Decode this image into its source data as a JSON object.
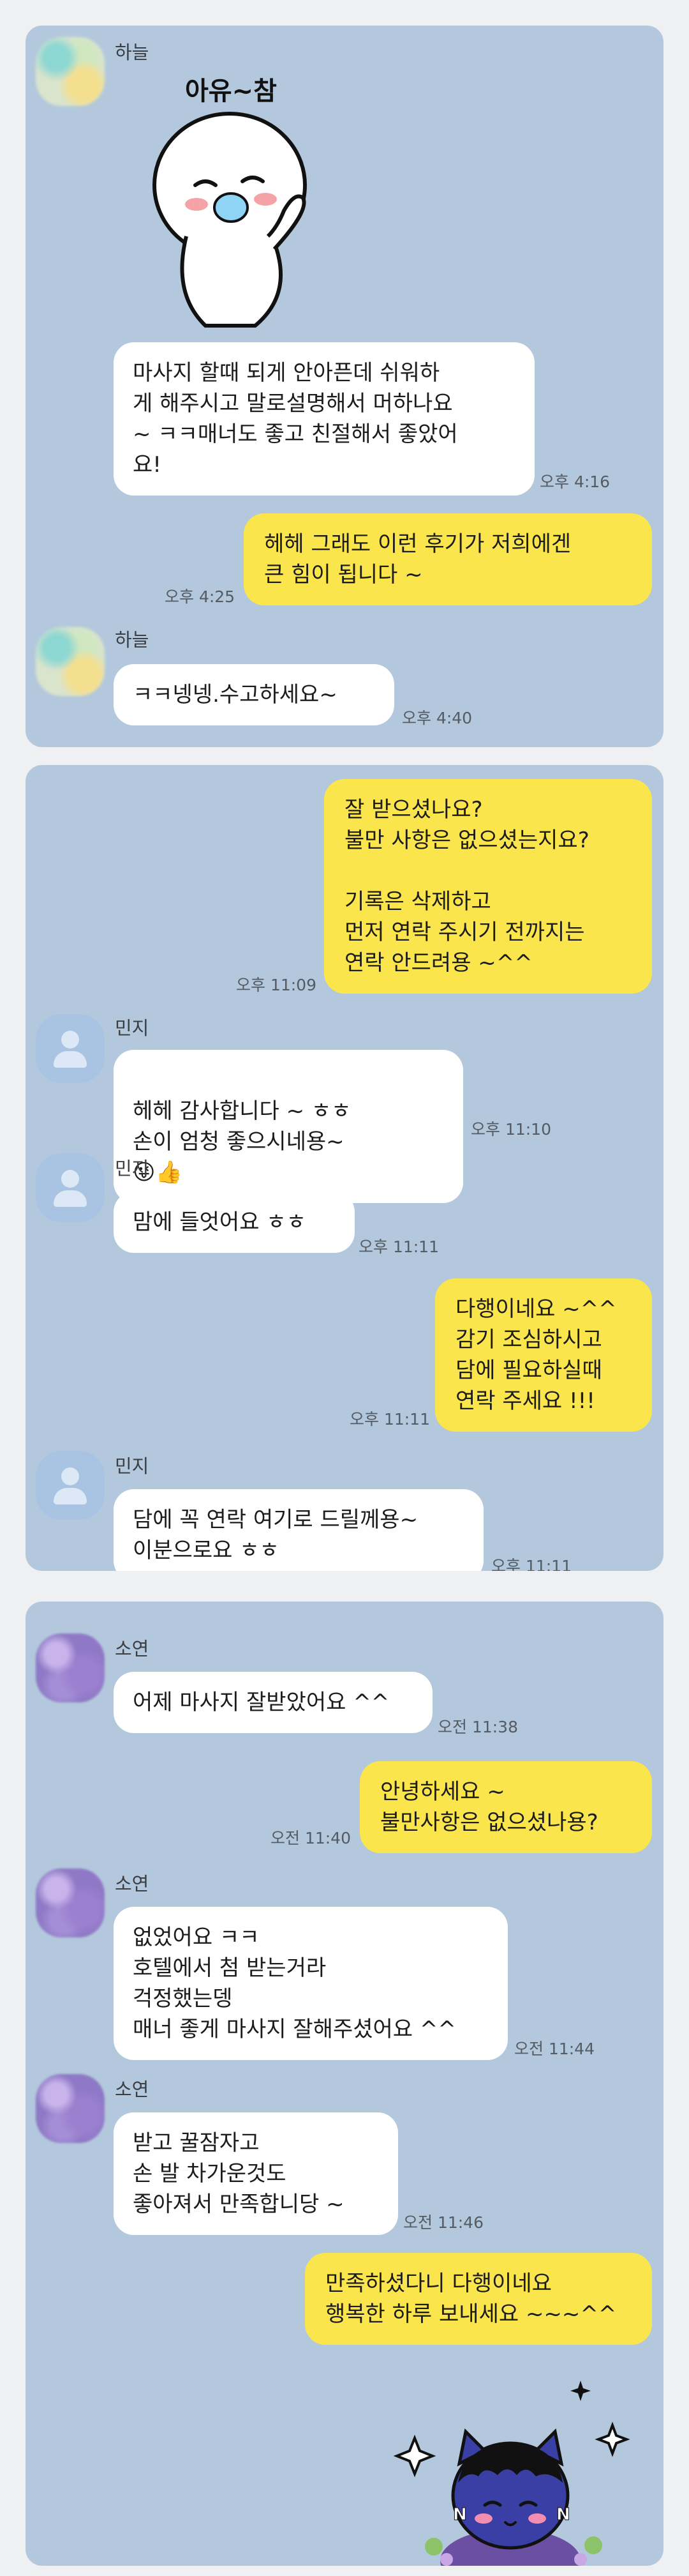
{
  "panels": [
    {
      "messages": [
        {
          "sender": "하늘",
          "sticker_text": "아유~참",
          "text": "마사지 할때 되게 안아픈데 쉬워하\n게 해주시고 말로설명해서 머하나요\n~ ㅋㅋ매너도 좋고 친절해서 좋았어\n요!",
          "time": "오후 4:16"
        },
        {
          "text": "헤헤 그래도 이런 후기가 저희에겐\n큰 힘이 됩니다 ~",
          "time": "오후 4:25"
        },
        {
          "sender": "하늘",
          "text": "ㅋㅋ넹넹.수고하세요~",
          "time": "오후 4:40"
        }
      ]
    },
    {
      "messages": [
        {
          "text": "잘 받으셨나요?\n불만 사항은 없으셨는지요?\n\n기록은 삭제하고\n먼저 연락 주시기 전까지는\n연락 안드려용 ~^^",
          "time": "오후 11:09"
        },
        {
          "sender": "민지",
          "text": "헤헤 감사합니다 ~ ㅎㅎ\n손이 엄청 좋으시네용~",
          "emoji": "😜👍",
          "time": "오후 11:10"
        },
        {
          "sender": "민지",
          "text": "맘에 들엇어요 ㅎㅎ",
          "time": "오후 11:11"
        },
        {
          "text": "다행이네요 ~^^\n감기 조심하시고\n담에 필요하실때\n연락 주세요 !!!",
          "time": "오후 11:11"
        },
        {
          "sender": "민지",
          "text": "담에 꼭 연락 여기로 드릴께용~\n이분으로요 ㅎㅎ",
          "time": "오후 11:11"
        }
      ]
    },
    {
      "messages": [
        {
          "sender": "소연",
          "text": "어제 마사지 잘받았어요 ^^",
          "time": "오전 11:38"
        },
        {
          "text": "안녕하세요 ~\n불만사항은 없으셨나용?",
          "time": "오전 11:40"
        },
        {
          "sender": "소연",
          "text": "없었어요 ㅋㅋ\n호텔에서 첨 받는거라\n걱정했는뎅\n매너 좋게 마사지 잘해주셨어요 ^^",
          "time": "오전 11:44"
        },
        {
          "sender": "소연",
          "text": "받고 꿀잠자고\n손 발 차가운것도\n좋아져서 만족합니당 ~",
          "time": "오전 11:46"
        },
        {
          "text": "만족하셨다니 다행이네요\n행복한 하루 보내세요 ~~~^^"
        }
      ]
    }
  ]
}
